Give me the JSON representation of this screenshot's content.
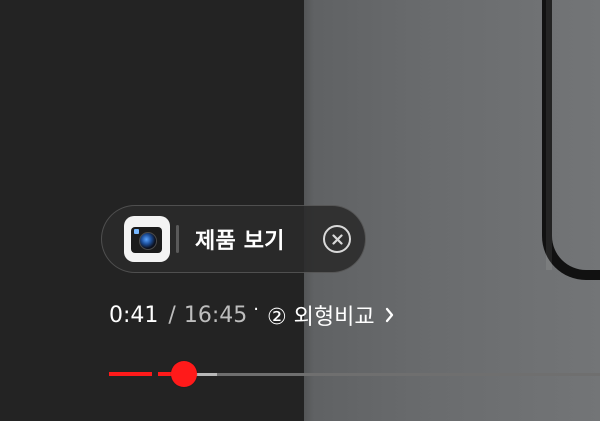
{
  "player": {
    "progress_fraction": 0.042
  },
  "product_chip": {
    "label": "제품 보기",
    "thumbnail_icon": "action-camera-icon",
    "close_icon": "close-circle-icon"
  },
  "time": {
    "current": "0:41",
    "separator": "/",
    "duration": "16:45"
  },
  "chapter": {
    "separator": "·",
    "label": "② 외형비교",
    "arrow_icon": "chevron-right-icon"
  },
  "colors": {
    "accent": "#ff1a1a",
    "text_primary": "#ffffff",
    "text_secondary": "#bdbdbd"
  }
}
